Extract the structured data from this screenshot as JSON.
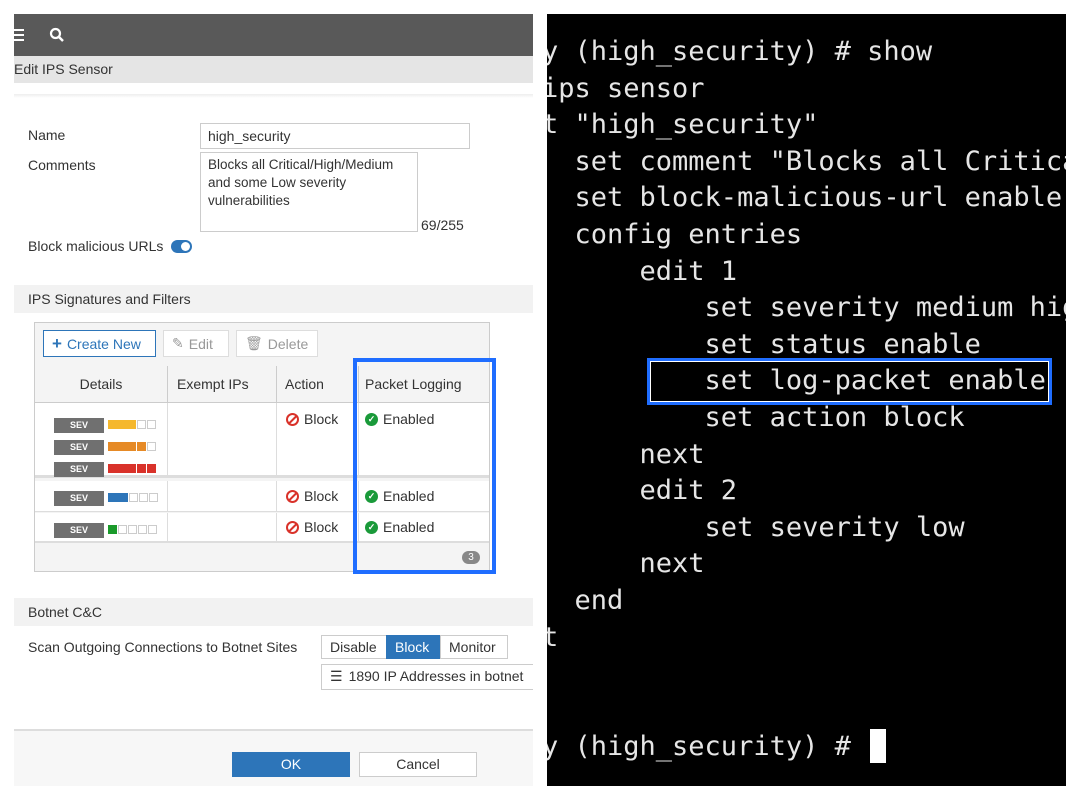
{
  "header": {
    "title": "Edit IPS Sensor",
    "menu_icon": "hamburger-icon",
    "search_icon": "search-icon"
  },
  "form": {
    "name_label": "Name",
    "name_value": "high_security",
    "comments_label": "Comments",
    "comments_value": "Blocks all Critical/High/Medium and some Low severity vulnerabilities",
    "comments_count": "69/255",
    "block_urls_label": "Block malicious URLs",
    "block_urls_enabled": true
  },
  "signatures": {
    "section_title": "IPS Signatures and Filters",
    "create_label": "Create New",
    "edit_label": "Edit",
    "delete_label": "Delete",
    "columns": [
      "Details",
      "Exempt IPs",
      "Action",
      "Packet Logging"
    ],
    "rows": [
      {
        "sev_label": "SEV",
        "severities": [
          "critical",
          "high",
          "medium"
        ],
        "exempt": "",
        "action": "Block",
        "logging": "Enabled"
      },
      {
        "sev_label": "SEV",
        "severities": [
          "low"
        ],
        "exempt": "",
        "action": "Block",
        "logging": "Enabled"
      },
      {
        "sev_label": "SEV",
        "severities": [
          "info"
        ],
        "exempt": "",
        "action": "Block",
        "logging": "Enabled"
      }
    ],
    "count": "3"
  },
  "botnet": {
    "section_title": "Botnet C&C",
    "scan_label": "Scan Outgoing Connections to Botnet Sites",
    "options": [
      "Disable",
      "Block",
      "Monitor"
    ],
    "selected": "Block",
    "list_label": "1890 IP Addresses in botnet"
  },
  "footer": {
    "ok": "OK",
    "cancel": "Cancel"
  },
  "colors": {
    "accent": "#2d75b9",
    "highlight": "#1f6dff",
    "terminal_bg": "#000000"
  },
  "terminal": {
    "lines": [
      "y (high_security) # show",
      "ips sensor",
      "t \"high_security\"",
      "  set comment \"Blocks all Critical/High/Medium and some Low severity vulnerabilities\"",
      "  set block-malicious-url enable",
      "  config entries",
      "      edit 1",
      "          set severity medium high critical",
      "          set status enable",
      "          set log-packet enable",
      "          set action block",
      "      next",
      "      edit 2",
      "          set severity low",
      "      next",
      "  end",
      "t",
      "",
      "",
      "y (high_security) # "
    ]
  }
}
